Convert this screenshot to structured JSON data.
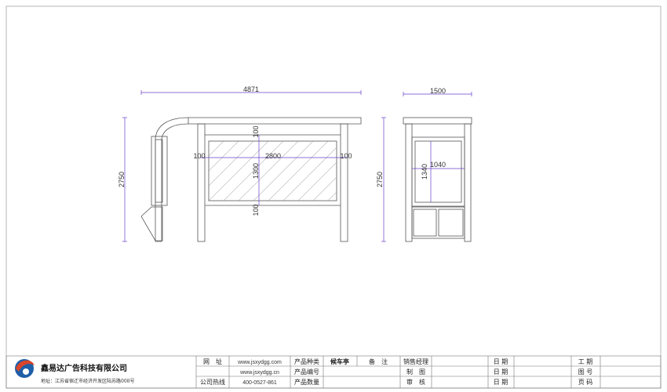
{
  "dimensions": {
    "overall_length": "4871",
    "side_width": "1500",
    "height_front": "2750",
    "height_side": "2750",
    "panel_width": "2800",
    "panel_height": "1300",
    "margin_left": "100",
    "margin_right": "100",
    "margin_top": "100",
    "margin_bottom": "100",
    "side_panel_width": "1040",
    "side_panel_height": "1340"
  },
  "title_block": {
    "company": "鑫易达广告科技有限公司",
    "address": "地址：江苏省宿迁市经济开发区陆苏路008号",
    "website_label": "网　址",
    "hotline_label": "公司热线",
    "website_1": "www.jsxydgg.com",
    "website_2": "www.jsxydgg.cn",
    "hotline": "400-0527-861",
    "product_type_label": "产品种类",
    "product_type": "候车亭",
    "product_code_label": "产品编号",
    "product_qty_label": "产品数量",
    "remark_label": "备　注",
    "sales_manager_label": "销售经理",
    "draw_label": "制　图",
    "review_label": "审　核",
    "date_label_1": "日 期",
    "date_label_2": "日 期",
    "date_label_3": "日 期",
    "period_label": "工 期",
    "drawing_no_label": "图 号",
    "page_label": "页 码"
  },
  "colors": {
    "dimension_line": "#6a3fc9",
    "frame_line": "#555555",
    "logo_red": "#d9452b",
    "logo_blue": "#1f5fa8"
  }
}
